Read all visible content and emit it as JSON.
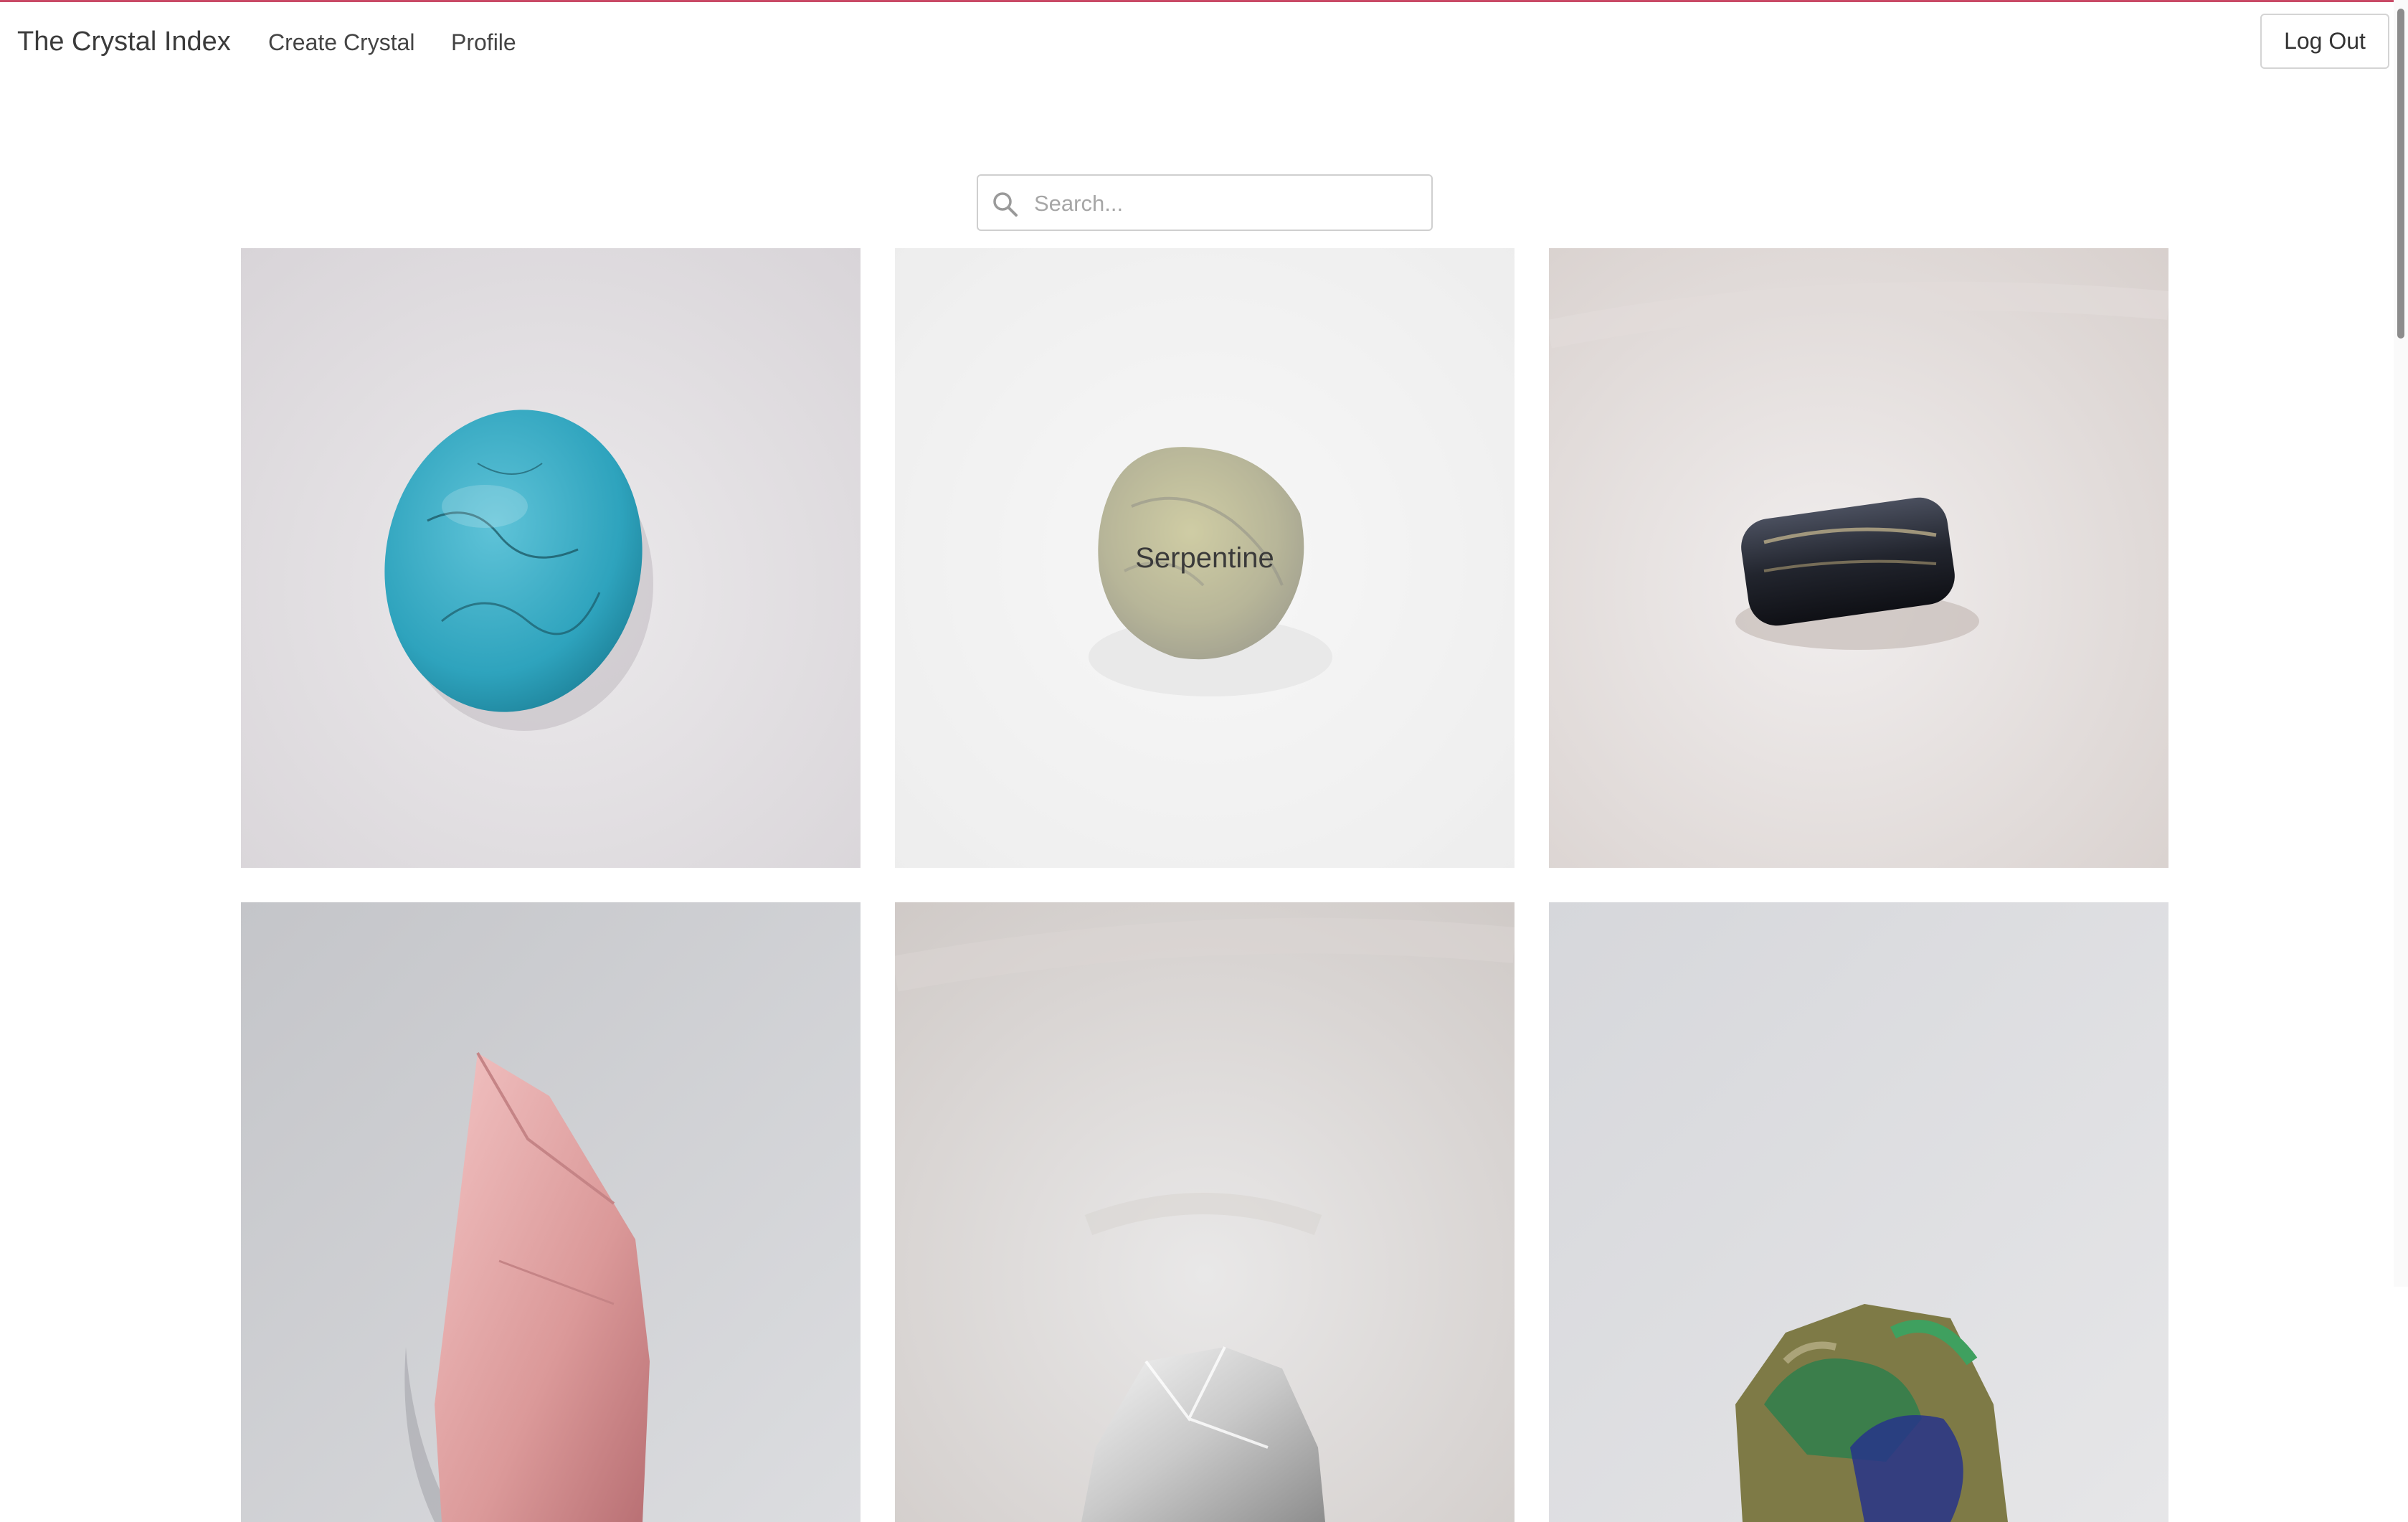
{
  "nav": {
    "brand": "The Crystal Index",
    "links": [
      "Create Crystal",
      "Profile"
    ],
    "logout_label": "Log Out"
  },
  "search": {
    "placeholder": "Search...",
    "value": "",
    "icon": "search-icon"
  },
  "crystals": [
    {
      "label": "",
      "image": "turquoise oval cabochon"
    },
    {
      "label": "Serpentine",
      "image": "serpentine tumbled stone",
      "hovered": true
    },
    {
      "label": "",
      "image": "tiger eye tumbled stone"
    },
    {
      "label": "",
      "image": "rose quartz rough"
    },
    {
      "label": "",
      "image": "clear quartz rough"
    },
    {
      "label": "",
      "image": "azurite malachite cluster"
    }
  ],
  "colors": {
    "accent_line": "#c94a66",
    "text": "#333333"
  }
}
